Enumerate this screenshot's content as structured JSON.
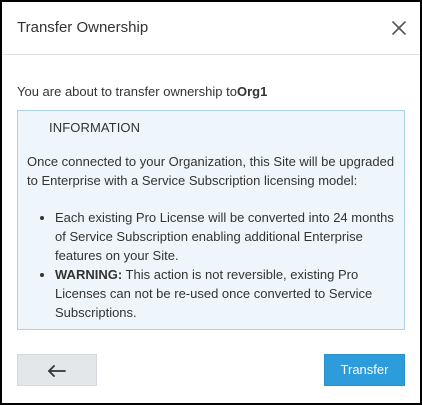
{
  "dialog": {
    "title": "Transfer Ownership",
    "close_icon": "close-icon"
  },
  "intro": {
    "text": "You are about to transfer ownership to",
    "org_name": "Org1"
  },
  "info": {
    "heading": "INFORMATION",
    "body": "Once connected to your Organization, this Site will be upgraded to Enterprise with a Service Subscription licensing model:",
    "bullets": [
      {
        "text": "Each existing Pro License will be converted into 24 months of Service Subscription enabling additional Enterprise features on your Site."
      },
      {
        "label": "WARNING:",
        "text": " This action is not reversible, existing Pro Licenses can not be re-used once converted to Service Subscriptions."
      }
    ]
  },
  "footer": {
    "back_icon": "arrow-left-icon",
    "transfer_label": "Transfer"
  },
  "colors": {
    "primary": "#2d9cdb",
    "info_bg": "#eef6fb",
    "info_border": "#a9d3ea",
    "secondary_button": "#e4e7ea"
  }
}
